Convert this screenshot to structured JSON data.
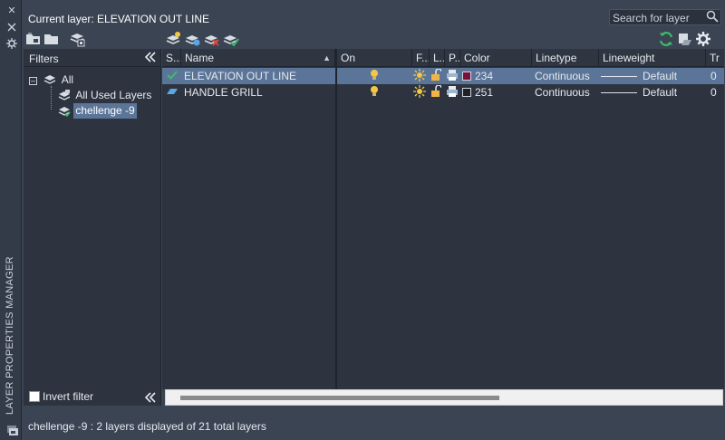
{
  "app": {
    "vertical_title": "LAYER PROPERTIES MANAGER",
    "current_layer_label": "Current layer: ELEVATION OUT LINE"
  },
  "search": {
    "placeholder": "Search for layer"
  },
  "icons": {
    "strip": [
      "close-icon",
      "auto-hide-icon",
      "properties-icon",
      "layer-manager-icon"
    ],
    "toolbar_left": [
      "new-property-filter-icon",
      "new-group-filter-icon",
      "layer-states-manager-icon"
    ],
    "toolbar_mid": [
      "new-layer-icon",
      "new-layer-vp-frozen-icon",
      "delete-layer-icon",
      "set-current-icon"
    ],
    "toolbar_right": [
      "refresh-icon",
      "layer-settings-icon",
      "gear-icon"
    ]
  },
  "filters": {
    "header": "Filters",
    "tree": [
      {
        "label": "All",
        "level": 0,
        "icon": "all-layers-icon",
        "selected": false
      },
      {
        "label": "All Used Layers",
        "level": 1,
        "icon": "property-filter-icon",
        "selected": false
      },
      {
        "label": "chellenge -9",
        "level": 1,
        "icon": "group-filter-icon",
        "selected": true
      }
    ],
    "invert_filter_label": "Invert filter",
    "invert_filter_checked": false
  },
  "grid": {
    "columns": [
      "S...",
      "Name",
      "On",
      "F...",
      "L...",
      "P...",
      "Color",
      "Linetype",
      "Lineweight",
      "Tr"
    ],
    "rows": [
      {
        "status": "current-check-icon",
        "name": "ELEVATION OUT LINE",
        "color_value": "234",
        "color_hex": "#7a0f3a",
        "linetype": "Continuous",
        "lineweight": "Default",
        "transparency": "0",
        "selected": true
      },
      {
        "status": "layer-icon",
        "name": "HANDLE GRILL",
        "color_value": "251",
        "color_hex": "#202124",
        "linetype": "Continuous",
        "lineweight": "Default",
        "transparency": "0",
        "selected": false
      }
    ]
  },
  "status_bar": {
    "text": "chellenge -9 : 2 layers displayed of 21 total layers"
  },
  "colors": {
    "background": "#3b4453",
    "pane": "#2d3440",
    "selection": "#5a7598",
    "accent_green": "#3dbb6b"
  }
}
